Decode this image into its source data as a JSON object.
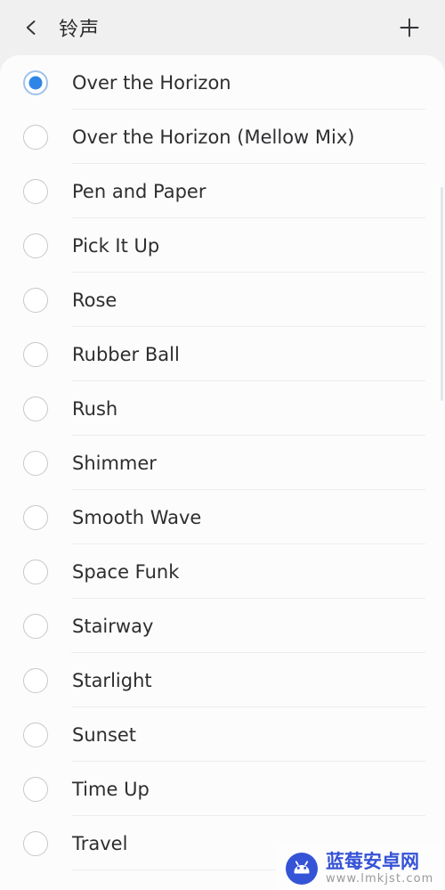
{
  "header": {
    "title": "铃声",
    "back_icon": "chevron-left-icon",
    "add_icon": "plus-icon"
  },
  "colors": {
    "accent": "#2f85e6",
    "accent_ring": "#9fc3e8",
    "page_background": "#f0f0f0",
    "card_background": "#fcfcfd",
    "divider": "#ededf0",
    "text": "#2e2e30",
    "radio_border": "#c6c8cb",
    "watermark_blue": "#3553d6",
    "watermark_gray": "#9a9a9e"
  },
  "list": {
    "selected_index": 0,
    "items": [
      {
        "label": "Over the Horizon",
        "selected": true
      },
      {
        "label": "Over the Horizon (Mellow Mix)",
        "selected": false
      },
      {
        "label": "Pen and Paper",
        "selected": false
      },
      {
        "label": "Pick It Up",
        "selected": false
      },
      {
        "label": "Rose",
        "selected": false
      },
      {
        "label": "Rubber Ball",
        "selected": false
      },
      {
        "label": "Rush",
        "selected": false
      },
      {
        "label": "Shimmer",
        "selected": false
      },
      {
        "label": "Smooth Wave",
        "selected": false
      },
      {
        "label": "Space Funk",
        "selected": false
      },
      {
        "label": "Stairway",
        "selected": false
      },
      {
        "label": "Starlight",
        "selected": false
      },
      {
        "label": "Sunset",
        "selected": false
      },
      {
        "label": "Time Up",
        "selected": false
      },
      {
        "label": "Travel",
        "selected": false
      }
    ]
  },
  "watermark": {
    "title": "蓝莓安卓网",
    "url": "www.lmkjst.com",
    "logo_icon": "android-robot-circle-icon"
  }
}
